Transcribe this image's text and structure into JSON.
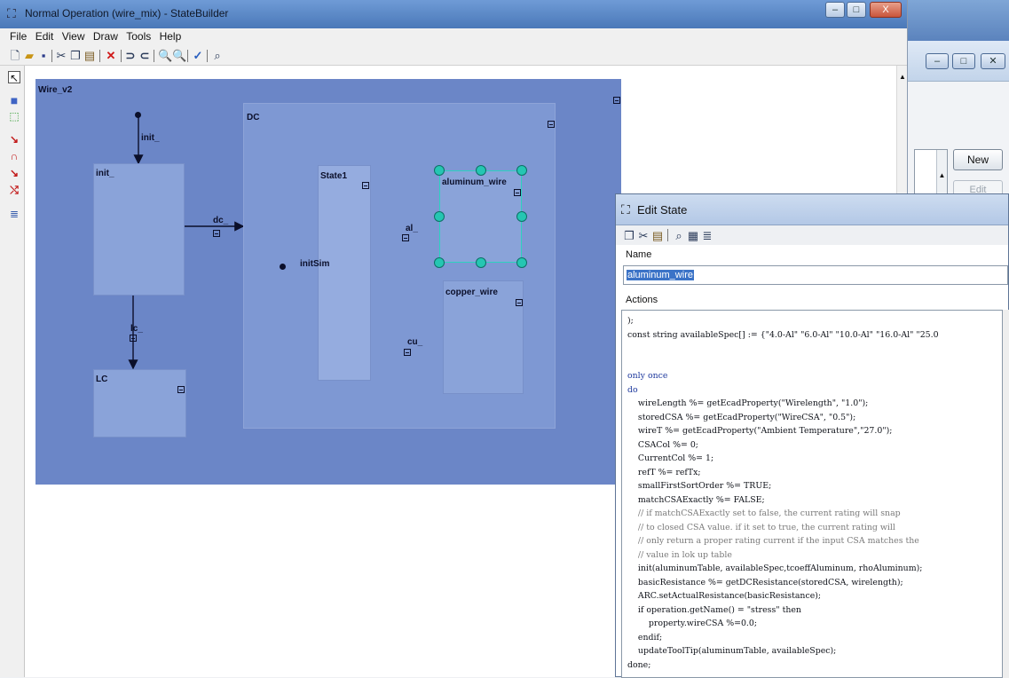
{
  "main_window": {
    "title": "Normal Operation (wire_mix)  - StateBuilder",
    "controls": {
      "minimize": "–",
      "maximize": "□",
      "close": "X"
    }
  },
  "menu": [
    "File",
    "Edit",
    "View",
    "Draw",
    "Tools",
    "Help"
  ],
  "toolbar_icons": [
    "new-icon",
    "open-icon",
    "save-icon",
    "cut-icon",
    "copy-icon",
    "paste-icon",
    "delete-icon",
    "undo-icon",
    "redo-icon",
    "zoom-in-icon",
    "zoom-out-icon",
    "check-icon",
    "find-icon"
  ],
  "palette_icons": [
    "pointer-icon",
    "state-icon",
    "selection-icon",
    "transition-icon",
    "loop-transition-icon",
    "arrow-transition-icon",
    "fork-transition-icon",
    "note-icon"
  ],
  "diagram": {
    "title": "Wire_v2",
    "states": {
      "init": "init_",
      "lc": "LC",
      "dc": "DC",
      "state1": "State1",
      "aluminum": "aluminum_wire",
      "copper": "copper_wire"
    },
    "transitions": {
      "init_in": "init_",
      "dc": "dc_",
      "lc": "lc_",
      "init_sim": "initSim",
      "al": "al_",
      "cu": "cu_"
    }
  },
  "edit_state": {
    "title": "Edit State",
    "name_label": "Name",
    "name_value": "aluminum_wire",
    "actions_label": "Actions",
    "code": [
      ");",
      "const string availableSpec[] := {\"4.0-Al\" \"6.0-Al\" \"10.0-Al\" \"16.0-Al\" \"25.0",
      "",
      "",
      "only once",
      "do",
      "    wireLength %= getEcadProperty(\"Wirelength\", \"1.0\");",
      "    storedCSA %= getEcadProperty(\"WireCSA\", \"0.5\");",
      "    wireT %= getEcadProperty(\"Ambient Temperature\",\"27.0\");",
      "    CSACol %= 0;",
      "    CurrentCol %= 1;",
      "    refT %= refTx;",
      "    smallFirstSortOrder %= TRUE;",
      "    matchCSAExactly %= FALSE;",
      "    // if matchCSAExactly set to false, the current rating will snap",
      "    // to closed CSA value. if it set to true, the current rating will",
      "    // only return a proper rating current if the input CSA matches the",
      "    // value in lok up table",
      "    init(aluminumTable, availableSpec,tcoeffAluminum, rhoAluminum);",
      "    basicResistance %= getDCResistance(storedCSA, wirelength);",
      "    ARC.setActualResistance(basicResistance);",
      "    if operation.getName() = \"stress\" then",
      "        property.wireCSA %=0.0;",
      "    endif;",
      "    updateToolTip(aluminumTable, availableSpec);",
      "done;"
    ]
  },
  "background_window": {
    "new_button": "New",
    "edit_button": "Edit"
  }
}
